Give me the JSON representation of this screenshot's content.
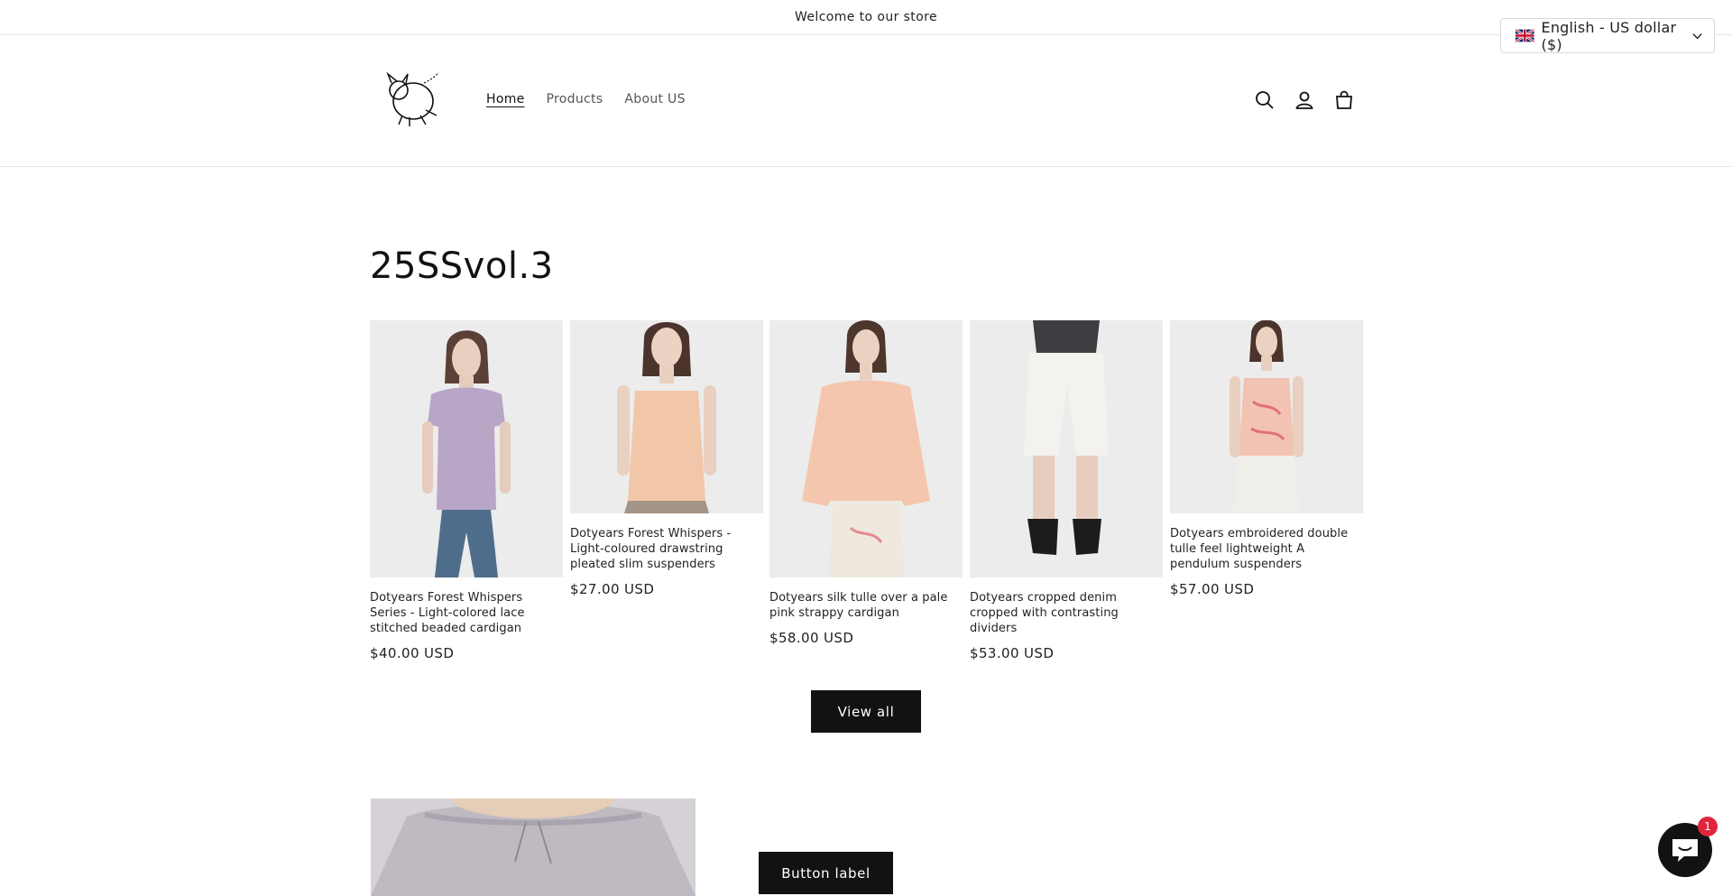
{
  "announcement": {
    "text": "Welcome to our store"
  },
  "localization": {
    "label": "English - US dollar ($)",
    "flag_icon": "uk-flag-icon"
  },
  "nav": {
    "items": [
      {
        "label": "Home",
        "active": true
      },
      {
        "label": "Products",
        "active": false
      },
      {
        "label": "About US",
        "active": false
      }
    ]
  },
  "header_icons": [
    "search-icon",
    "account-icon",
    "cart-icon"
  ],
  "collection": {
    "title": "25SSvol.3",
    "products": [
      {
        "title": "Dotyears Forest Whispers Series - Light-colored lace stitched beaded cardigan",
        "price": "$40.00 USD"
      },
      {
        "title": "Dotyears Forest Whispers - Light-coloured drawstring pleated slim suspenders",
        "price": "$27.00 USD"
      },
      {
        "title": "Dotyears silk tulle over a pale pink strappy cardigan",
        "price": "$58.00 USD"
      },
      {
        "title": "Dotyears cropped denim cropped with contrasting dividers",
        "price": "$53.00 USD"
      },
      {
        "title": "Dotyears embroidered double tulle feel lightweight A pendulum suspenders",
        "price": "$57.00 USD"
      }
    ],
    "view_all_label": "View all"
  },
  "feature": {
    "button_label": "Button label"
  },
  "chat": {
    "badge_count": "1"
  },
  "colors": {
    "accent": "#121212",
    "badge": "#e0263d"
  }
}
